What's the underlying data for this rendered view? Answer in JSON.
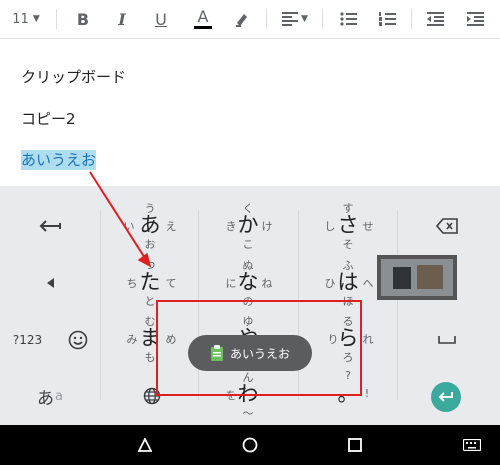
{
  "toolbar": {
    "font_size": "11",
    "bold": "B",
    "italic": "I",
    "underline": "U",
    "text_color": "A"
  },
  "document": {
    "lines": [
      "クリップボード",
      "コピー2",
      "あいうえお"
    ]
  },
  "keyboard": {
    "rows": [
      {
        "main": "あ",
        "top": "う",
        "left": "い",
        "right": "え",
        "bottom": "お"
      },
      {
        "main": "か",
        "top": "く",
        "left": "き",
        "right": "け",
        "bottom": "こ"
      },
      {
        "main": "さ",
        "top": "す",
        "left": "し",
        "right": "せ",
        "bottom": "そ"
      },
      {
        "main": "た",
        "top": "つ",
        "left": "ち",
        "right": "て",
        "bottom": "と"
      },
      {
        "main": "な",
        "top": "ぬ",
        "left": "に",
        "right": "ね",
        "bottom": "の"
      },
      {
        "main": "は",
        "top": "ふ",
        "left": "ひ",
        "right": "へ",
        "bottom": "ほ"
      },
      {
        "main": "ま",
        "top": "む",
        "left": "み",
        "right": "め",
        "bottom": "も"
      },
      {
        "main": "や",
        "top": "ゆ",
        "left": "",
        "right": "",
        "bottom": "よ"
      },
      {
        "main": "ら",
        "top": "る",
        "left": "り",
        "right": "れ",
        "bottom": "ろ"
      },
      {
        "main": "わ",
        "top": "ん",
        "left": "を",
        "right": "",
        "bottom": "～"
      }
    ],
    "symbols_key": "?123",
    "kana_key": "あ",
    "kana_key_sub": "a",
    "punct_question": "?",
    "punct_exclaim": "!",
    "punct_dot": "。"
  },
  "toast": {
    "text": "あいうえお"
  },
  "colors": {
    "selection": "#aeddf2",
    "annotation": "#e0201e",
    "enter_key": "#3ba99c"
  }
}
